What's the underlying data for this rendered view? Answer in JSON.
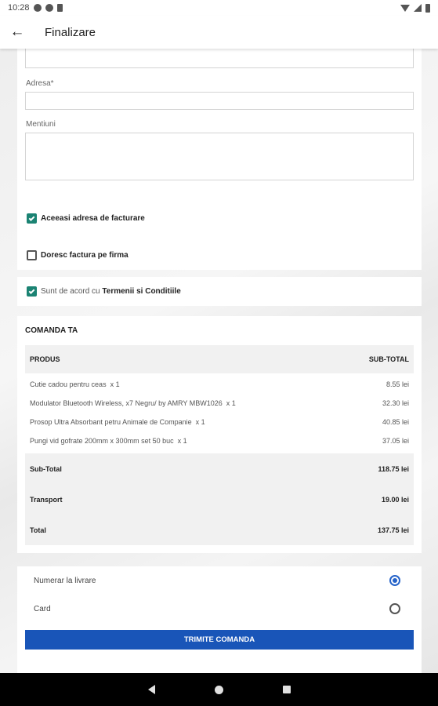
{
  "status_bar": {
    "time": "10:28"
  },
  "header": {
    "title": "Finalizare"
  },
  "form": {
    "address_label": "Adresa*",
    "notes_label": "Mentiuni"
  },
  "options": {
    "same_billing_label": "Aceeasi adresa de facturare",
    "same_billing_checked": true,
    "company_invoice_label": "Doresc factura pe firma",
    "company_invoice_checked": false,
    "terms_prefix": "Sunt de acord cu",
    "terms_link": "Termenii si Conditiile",
    "terms_checked": true
  },
  "order": {
    "title": "COMANDA TA",
    "col_product": "PRODUS",
    "col_subtotal": "SUB-TOTAL",
    "items": [
      {
        "name": "Cutie cadou pentru ceas",
        "qty": "x  1",
        "price": "8.55 lei"
      },
      {
        "name": "Modulator Bluetooth Wireless, x7 Negru/ by AMRY MBW1026",
        "qty": "x  1",
        "price": "32.30 lei"
      },
      {
        "name": "Prosop Ultra Absorbant petru Animale de Companie",
        "qty": "x  1",
        "price": "40.85 lei"
      },
      {
        "name": "Pungi vid gofrate 200mm x 300mm set 50 buc",
        "qty": "x  1",
        "price": "37.05 lei"
      }
    ],
    "subtotal_label": "Sub-Total",
    "subtotal_value": "118.75 lei",
    "shipping_label": "Transport",
    "shipping_value": "19.00 lei",
    "total_label": "Total",
    "total_value": "137.75 lei"
  },
  "payment": {
    "cash_label": "Numerar la livrare",
    "card_label": "Card",
    "selected": "cash",
    "submit_label": "TRIMITE COMANDA"
  },
  "colors": {
    "accent_blue": "#1955b8",
    "check_green": "#1b8373"
  }
}
